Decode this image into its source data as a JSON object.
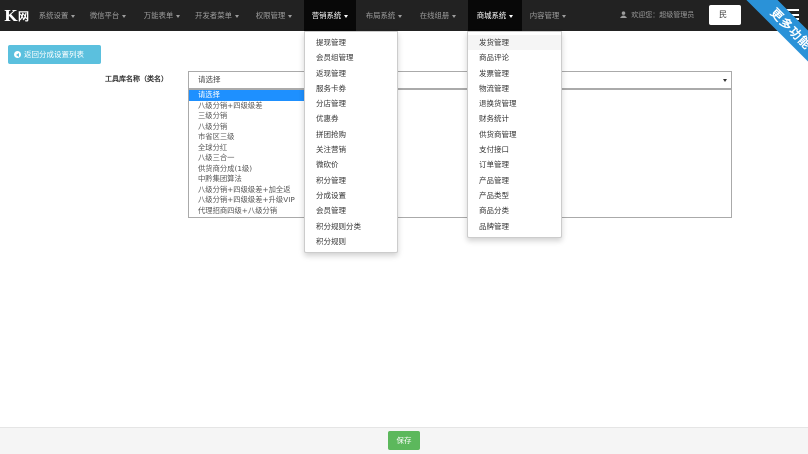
{
  "brand": {
    "glyph": "K",
    "text": "网"
  },
  "nav": [
    {
      "label": "系统设置",
      "name": "nav-system-settings"
    },
    {
      "label": "微信平台",
      "name": "nav-wechat-platform"
    },
    {
      "label": "万能表单",
      "name": "nav-universal-form"
    },
    {
      "label": "开发者菜单",
      "name": "nav-developer-menu"
    },
    {
      "label": "权限管理",
      "name": "nav-permission-management"
    },
    {
      "label": "营销系统",
      "name": "nav-marketing-system"
    },
    {
      "label": "布局系统",
      "name": "nav-layout-system"
    },
    {
      "label": "在线组册",
      "name": "nav-online-album"
    },
    {
      "label": "商城系统",
      "name": "nav-mall-system"
    },
    {
      "label": "内容管理",
      "name": "nav-content-management"
    }
  ],
  "user": {
    "welcome": "欢迎您：超级管理员"
  },
  "top_button": {
    "label": "民"
  },
  "ribbon": {
    "label": "更多功能"
  },
  "back_button": {
    "label": "返回分成设置列表"
  },
  "form": {
    "label": "工具库名称（类名）",
    "selected": "请选择",
    "options": [
      "请选择",
      "八级分销+四级级差",
      "三级分销",
      "八级分销",
      "市省区三级",
      "全球分红",
      "八级三合一",
      "供货商分成(1级)",
      "中黔集团算法",
      "八级分销+四级级差+加全返",
      "八级分销+四级级差+升级VIP",
      "代理招商四级+八级分销"
    ]
  },
  "marketing_menu": [
    "提现管理",
    "会员组管理",
    "返现管理",
    "服务卡券",
    "分店管理",
    "优惠券",
    "拼团抢购",
    "关注营销",
    "微砍价",
    "积分管理",
    "分成设置",
    "会员管理",
    "积分规则分类",
    "积分规则"
  ],
  "mall_menu": [
    "发货管理",
    "商品评论",
    "发票管理",
    "物流管理",
    "退换货管理",
    "财务统计",
    "供货商管理",
    "支付接口",
    "订单管理",
    "产品管理",
    "产品类型",
    "商品分类",
    "品牌管理"
  ],
  "footer": {
    "save_label": "保存"
  },
  "colors": {
    "navbar": "#222222",
    "active_nav": "#080808",
    "ribbon": "#2a92d8",
    "back_button": "#5bc0de",
    "save_button": "#5cb85c",
    "selected_option": "#1e90ff"
  }
}
